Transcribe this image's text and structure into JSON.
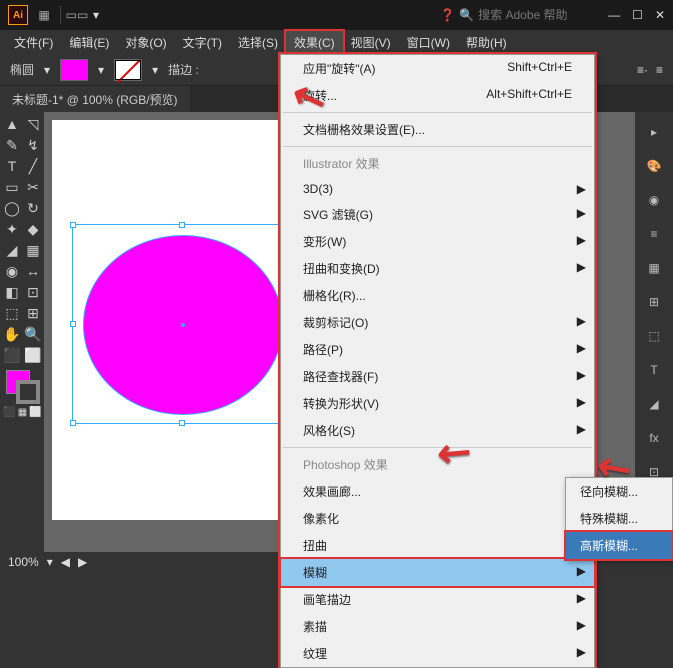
{
  "titlebar": {
    "search_placeholder": "搜索 Adobe 帮助"
  },
  "menubar": {
    "items": [
      "文件(F)",
      "编辑(E)",
      "对象(O)",
      "文字(T)",
      "选择(S)",
      "效果(C)",
      "视图(V)",
      "窗口(W)",
      "帮助(H)"
    ],
    "active": 5
  },
  "ctrl": {
    "shape": "椭圆",
    "stroke_label": "描边 :"
  },
  "doc": {
    "tab": "未标题-1* @ 100% (RGB/预览)"
  },
  "status": {
    "zoom": "100%"
  },
  "effects_menu": {
    "apply": "应用\"旋转\"(A)",
    "apply_sc": "Shift+Ctrl+E",
    "redo": "旋转...",
    "redo_sc": "Alt+Shift+Ctrl+E",
    "raster": "文档栅格效果设置(E)...",
    "hdr1": "Illustrator 效果",
    "i_items": [
      "3D(3)",
      "SVG 滤镜(G)",
      "变形(W)",
      "扭曲和变换(D)",
      "栅格化(R)...",
      "裁剪标记(O)",
      "路径(P)",
      "路径查找器(F)",
      "转换为形状(V)",
      "风格化(S)"
    ],
    "hdr2": "Photoshop 效果",
    "p_items": [
      "效果画廊...",
      "像素化",
      "扭曲",
      "模糊",
      "画笔描边",
      "素描",
      "纹理"
    ],
    "hl": "模糊"
  },
  "blur_submenu": {
    "items": [
      "径向模糊...",
      "特殊模糊...",
      "高斯模糊..."
    ],
    "hl": "高斯模糊..."
  }
}
